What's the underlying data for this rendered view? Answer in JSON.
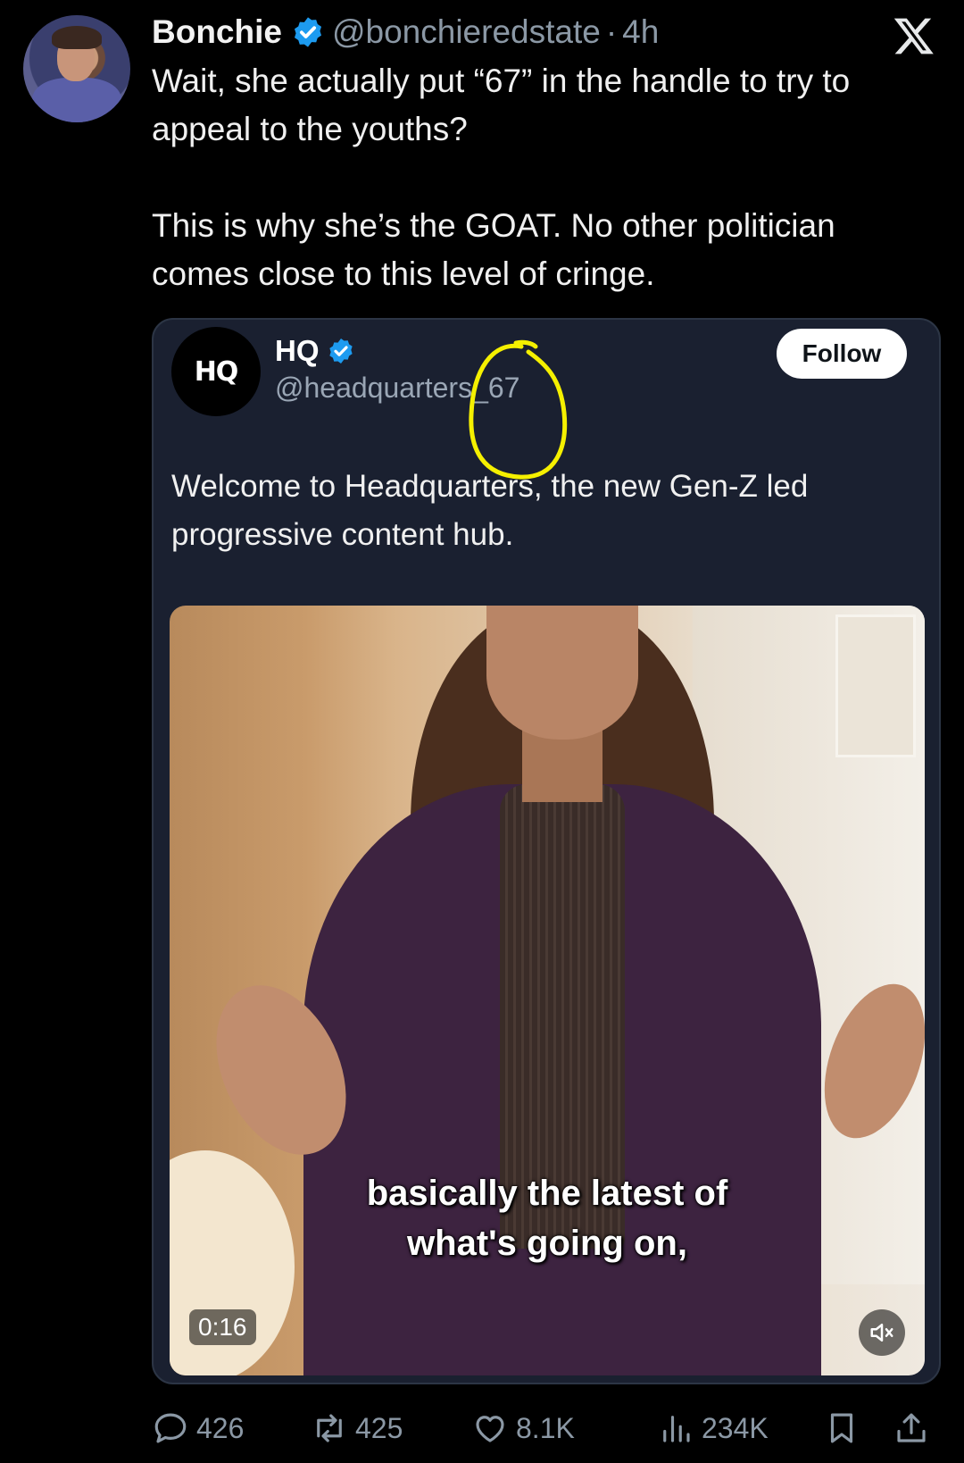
{
  "tweet": {
    "author_name": "Bonchie",
    "author_handle": "@bonchieredstate",
    "separator": "·",
    "time": "4h",
    "text_p1": "Wait, she actually put “67” in the handle to try to appeal to the youths?",
    "text_p2": "This is why she’s the GOAT. No other politician comes close to this level of cringe."
  },
  "quoted": {
    "avatar_text": "HQ",
    "name": "HQ",
    "handle": "@headquarters_67",
    "follow_label": "Follow",
    "text": "Welcome to Headquarters, the new Gen-Z led progressive content hub.",
    "video": {
      "caption_line1": "basically the latest of",
      "caption_line2": "what's going on,",
      "timestamp": "0:16"
    }
  },
  "actions": {
    "replies": "426",
    "reposts": "425",
    "likes": "8.1K",
    "views": "234K"
  },
  "icons": [
    "verified-badge-icon",
    "x-logo-icon",
    "reply-icon",
    "repost-icon",
    "like-icon",
    "views-icon",
    "bookmark-icon",
    "share-icon",
    "mute-icon"
  ],
  "colors": {
    "background": "#000000",
    "verified": "#1d9bf0",
    "annotation": "#f5f000",
    "muted_text": "#8b98a5"
  }
}
